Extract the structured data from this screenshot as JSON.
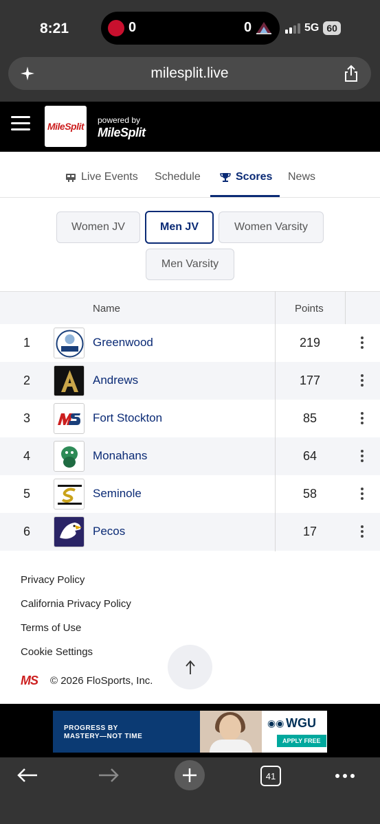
{
  "status_bar": {
    "time": "8:21",
    "score_left": "0",
    "score_right": "0",
    "network": "5G",
    "battery": "60"
  },
  "browser": {
    "url": "milesplit.live",
    "tab_count": "41"
  },
  "site_header": {
    "logo_text": "MileSplit",
    "powered_by": "powered by",
    "powered_brand": "MileSplit"
  },
  "tabs": [
    {
      "label": "Live Events",
      "icon": "scoreboard-icon",
      "active": false
    },
    {
      "label": "Schedule",
      "active": false
    },
    {
      "label": "Scores",
      "icon": "trophy-icon",
      "active": true
    },
    {
      "label": "News",
      "active": false
    }
  ],
  "divisions": [
    {
      "label": "Women JV",
      "active": false
    },
    {
      "label": "Men JV",
      "active": true
    },
    {
      "label": "Women Varsity",
      "active": false
    },
    {
      "label": "Men Varsity",
      "active": false
    }
  ],
  "table": {
    "headers": {
      "name": "Name",
      "points": "Points"
    },
    "rows": [
      {
        "rank": "1",
        "team": "Greenwood",
        "points": "219"
      },
      {
        "rank": "2",
        "team": "Andrews",
        "points": "177"
      },
      {
        "rank": "3",
        "team": "Fort Stockton",
        "points": "85"
      },
      {
        "rank": "4",
        "team": "Monahans",
        "points": "64"
      },
      {
        "rank": "5",
        "team": "Seminole",
        "points": "58"
      },
      {
        "rank": "6",
        "team": "Pecos",
        "points": "17"
      }
    ]
  },
  "footer": {
    "links": [
      "Privacy Policy",
      "California Privacy Policy",
      "Terms of Use",
      "Cookie Settings"
    ],
    "copyright": "© 2026 FloSports, Inc.",
    "logo_text": "MS"
  },
  "ad": {
    "headline_1": "PROGRESS BY",
    "headline_2": "MASTERY—NOT TIME",
    "brand": "WGU",
    "cta": "APPLY FREE"
  },
  "colors": {
    "brand_navy": "#0a2a75",
    "brand_red": "#cc1f1f",
    "chrome_dark": "#343434"
  }
}
